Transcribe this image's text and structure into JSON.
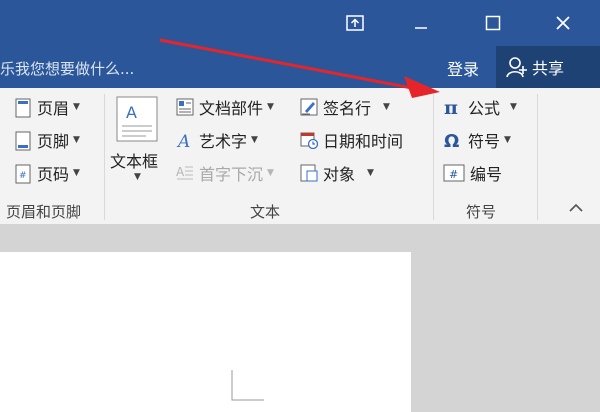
{
  "window": {
    "controls": {
      "restore": "⧉",
      "maximize": "☐",
      "close": "✕"
    }
  },
  "tellme": {
    "text": "乐我您想要做什么...",
    "login": "登录",
    "share": "共享"
  },
  "ribbon": {
    "header_footer": {
      "items": [
        "页眉",
        "页脚",
        "页码"
      ],
      "label": "页眉和页脚"
    },
    "text_group": {
      "textbox": "文本框",
      "parts": "文档部件",
      "wordart": "艺术字",
      "dropcap": "首字下沉",
      "signature": "签名行",
      "datetime": "日期和时间",
      "object": "对象",
      "label": "文本"
    },
    "symbols": {
      "equation": "公式",
      "symbol": "符号",
      "number": "编号",
      "label": "符号"
    }
  },
  "colors": {
    "titlebar": "#2b579a",
    "share_bg": "#1e4274",
    "arrow": "#e5252a"
  }
}
